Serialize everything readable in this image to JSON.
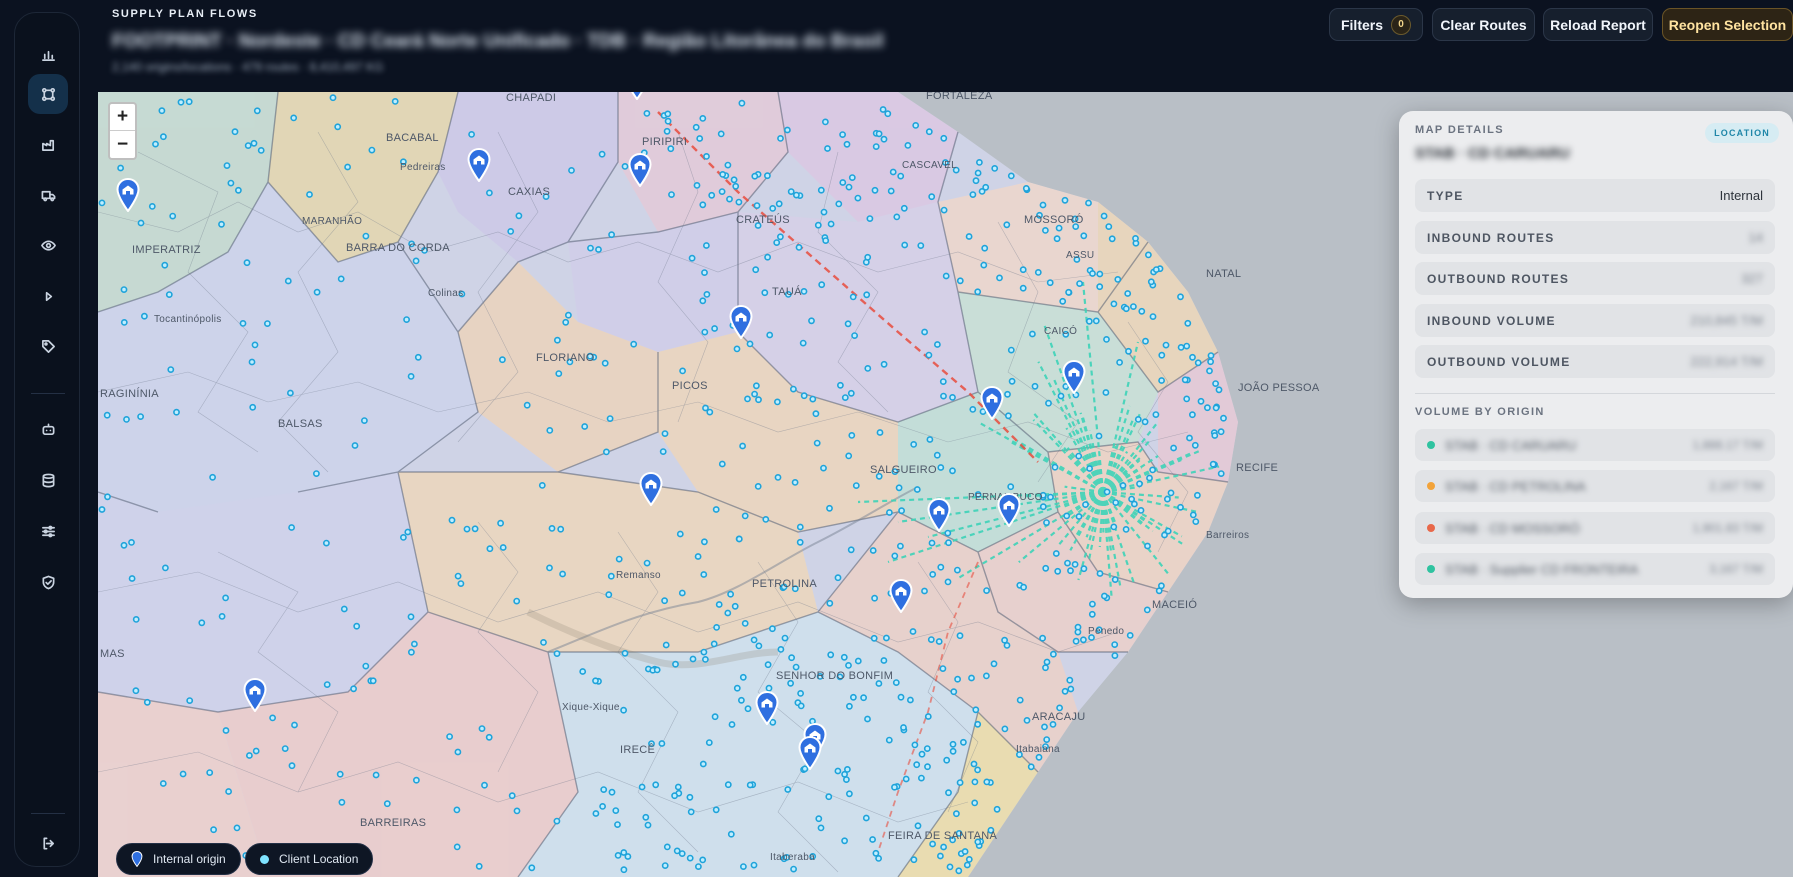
{
  "header": {
    "eyebrow": "SUPPLY PLAN FLOWS",
    "title": "FOOTPRINT · Nordeste · CD Ceará Norte Unificado · TDB · Região Litorânea do Brasil",
    "subtitle": "2,140 origins/locations · 479 routes · 8,410,497 KG"
  },
  "toolbar": {
    "filters_label": "Filters",
    "filters_count": "0",
    "clear_routes_label": "Clear Routes",
    "reload_report_label": "Reload Report",
    "reopen_selection_label": "Reopen Selection"
  },
  "sidebar": {
    "items": [
      {
        "name": "charts",
        "icon": "bar-chart-icon"
      },
      {
        "name": "flows",
        "icon": "route-icon",
        "active": true
      },
      {
        "name": "facilities",
        "icon": "factory-icon"
      },
      {
        "name": "transport",
        "icon": "truck-icon"
      },
      {
        "name": "visibility",
        "icon": "eye-icon"
      },
      {
        "name": "run",
        "icon": "play-icon"
      },
      {
        "name": "pricing",
        "icon": "tag-icon"
      },
      {
        "name": "automation",
        "icon": "robot-icon"
      },
      {
        "name": "database",
        "icon": "database-icon"
      },
      {
        "name": "settings",
        "icon": "sliders-icon"
      },
      {
        "name": "security",
        "icon": "shield-icon"
      },
      {
        "name": "logout",
        "icon": "logout-icon"
      }
    ]
  },
  "map": {
    "zoom_in": "+",
    "zoom_out": "−",
    "labels": [
      {
        "text": "CHAPADI",
        "big": true
      },
      {
        "text": "PIRIPIRI",
        "big": true
      },
      {
        "text": "FORTALEZA",
        "big": true
      },
      {
        "text": "BACABAL",
        "big": true
      },
      {
        "text": "Pedreiras"
      },
      {
        "text": "CAXIAS",
        "big": true
      },
      {
        "text": "CRATEÚS",
        "big": true
      },
      {
        "text": "CASCAVEL"
      },
      {
        "text": "MOSSORÓ",
        "big": true
      },
      {
        "text": "IMPERATRIZ",
        "big": true
      },
      {
        "text": "MARANHÃO"
      },
      {
        "text": "BARRA DO CORDA",
        "big": true
      },
      {
        "text": "ASSU"
      },
      {
        "text": "NATAL",
        "big": true
      },
      {
        "text": "Colinas"
      },
      {
        "text": "TAUÁ",
        "big": true
      },
      {
        "text": "Tocantinópolis"
      },
      {
        "text": "CAICÓ"
      },
      {
        "text": "FLORIANO",
        "big": true
      },
      {
        "text": "RAGINÍNIA",
        "big": true
      },
      {
        "text": "PICOS",
        "big": true
      },
      {
        "text": "JOÃO PESSOA",
        "big": true
      },
      {
        "text": "BALSAS",
        "big": true
      },
      {
        "text": "SALGUEIRO",
        "big": true
      },
      {
        "text": "RECIFE",
        "big": true
      },
      {
        "text": "PERNAMBUCO"
      },
      {
        "text": "Barreiros"
      },
      {
        "text": "PETROLINA",
        "big": true
      },
      {
        "text": "MACEIÓ",
        "big": true
      },
      {
        "text": "Remanso"
      },
      {
        "text": "MAS",
        "big": true
      },
      {
        "text": "SENHOR DO BONFIM",
        "big": true
      },
      {
        "text": "Penedo"
      },
      {
        "text": "Xique-Xique"
      },
      {
        "text": "ARACAJU",
        "big": true
      },
      {
        "text": "IRECÊ",
        "big": true
      },
      {
        "text": "Itabaiana"
      },
      {
        "text": "BARREIRAS",
        "big": true
      },
      {
        "text": "FEIRA DE SANTANA",
        "big": true
      },
      {
        "text": "Itaberaba"
      }
    ]
  },
  "legend": {
    "internal_origin": "Internal origin",
    "client_location": "Client Location"
  },
  "details": {
    "eyebrow": "MAP DETAILS",
    "tag": "LOCATION",
    "name": "STAB · CD CARUARU",
    "rows": [
      {
        "key": "TYPE",
        "value": "Internal",
        "blurred": false
      },
      {
        "key": "INBOUND ROUTES",
        "value": "14",
        "blurred": true
      },
      {
        "key": "OUTBOUND ROUTES",
        "value": "327",
        "blurred": true
      },
      {
        "key": "INBOUND VOLUME",
        "value": "210,845 T/M",
        "blurred": true
      },
      {
        "key": "OUTBOUND VOLUME",
        "value": "222,914 T/M",
        "blurred": true
      }
    ],
    "section_title": "VOLUME BY ORIGIN",
    "origins": [
      {
        "name": "STAB · CD CARUARU",
        "value": "1,888.17 T/M",
        "color": "#2fc3a0"
      },
      {
        "name": "STAB · CD PETROLINA",
        "value": "2,167 T/M",
        "color": "#f2a33a"
      },
      {
        "name": "STAB · CD MOSSORÓ",
        "value": "1,901.83 T/M",
        "color": "#e8684a"
      },
      {
        "name": "STAB · Supplier CD FRONTEIRA",
        "value": "3,167 T/M",
        "color": "#2fc3a0"
      }
    ]
  },
  "colors": {
    "accent": "#1f86a8",
    "internal_marker": "#2f6fe0",
    "client_dot": "#2aaee0",
    "flow_cyan": "#3ed3b8",
    "flow_red": "#e84c3d"
  }
}
